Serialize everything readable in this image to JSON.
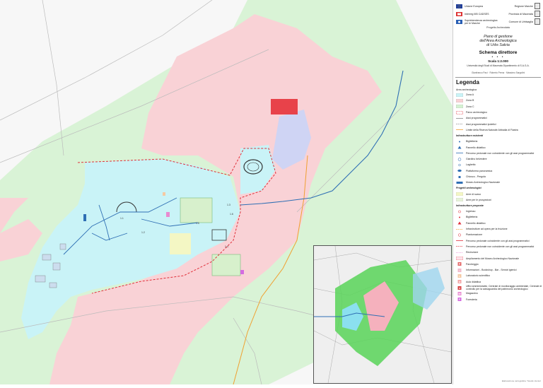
{
  "header": {
    "logos": [
      {
        "left": "Unione Europea",
        "right": "Regione Marche"
      },
      {
        "left": "Interreg IIIB CADSES",
        "right": "Provincia di Macerata"
      },
      {
        "left": "Soprintendenza archeologica per le Marche",
        "right": "Comune di Urbisaglia"
      }
    ],
    "project": "Progetto Archeodata",
    "title_lines": [
      "Piano di gestione",
      "dell'Area Archeologica",
      "di Urbs Salvia"
    ],
    "subtitle": "Schema direttore",
    "dots": "• • •",
    "scale": "Scala 1:2.000",
    "university": "Università degli Studi di Macerata Dipartimento di S.A.G.A.",
    "authors": "Gianfranco Paci · Roberto Perna · Massimo Sargolini"
  },
  "legend": {
    "title": "Legenda",
    "area_heading": "Area archeologica",
    "zones": [
      {
        "label": "Zona A",
        "color": "#c9f3f7"
      },
      {
        "label": "Zona B",
        "color": "#f9d2d6"
      },
      {
        "label": "Zona C",
        "color": "#d5f2d2"
      }
    ],
    "area_items": [
      {
        "label": "Parco archeologico",
        "style": "dash-red"
      },
      {
        "label": "Assi programmatici",
        "style": "line-grey"
      },
      {
        "label": "Assi programmatici ipotetici",
        "style": "dash-grey"
      },
      {
        "label": "Limite della Riserva Naturale Abbadia di Fiastra",
        "style": "line-orange"
      }
    ],
    "existing_heading": "Infrastrutture esistenti",
    "existing": [
      {
        "label": "Biglietteria",
        "icon": "dot"
      },
      {
        "label": "Pannello didattico",
        "icon": "triangle"
      },
      {
        "label": "Percorso pedonale non coincidente con gli assi programmatici",
        "icon": "line-blue"
      },
      {
        "label": "Giardino belvedere",
        "icon": "circle"
      },
      {
        "label": "Laghetto",
        "icon": "small-circle"
      },
      {
        "label": "Piattaforma panoramica",
        "icon": "ellipse"
      },
      {
        "label": "Chiosco - Pergola",
        "icon": "square"
      },
      {
        "label": "Museo Archeologico Nazionale",
        "icon": "rect-blue"
      }
    ],
    "projects_heading": "Progetti archeologici",
    "projects": [
      {
        "label": "Aree di scavo",
        "color": "#f4f7c4"
      },
      {
        "label": "Aree per le prospezioni",
        "color": "#e6f2d8"
      }
    ],
    "planned_heading": "Infrastrutture proposte",
    "planned": [
      {
        "label": "Ingresso",
        "icon": "entry"
      },
      {
        "label": "Biglietteria",
        "icon": "dot-red"
      },
      {
        "label": "Pannello didattico",
        "icon": "triangle-red"
      },
      {
        "label": "Infrastrutture ad opera per la fruizione",
        "icon": "dash-orange"
      },
      {
        "label": "Piantumazione",
        "icon": "circle-red"
      },
      {
        "label": "Percorso pedonale coincidente con gli assi programmatici",
        "icon": "line-red"
      },
      {
        "label": "Percorso pedonale non coincidente con gli assi programmatici",
        "icon": "dash-red2"
      },
      {
        "label": "Recinzione",
        "icon": "dash-pink"
      },
      {
        "label": "Ampliamento del Museo Archeologico Nazionale",
        "icon": "hatch-pink"
      },
      {
        "label": "Parcheggio",
        "icon": "P",
        "color": "#e46a6a"
      },
      {
        "label": "Informazioni - Bookshop - Bar - Servizi igienici",
        "icon": "I",
        "color": "#f0b7c9"
      },
      {
        "label": "Laboratorio scientifico",
        "icon": "L",
        "color": "#f5c9a3"
      },
      {
        "label": "Aula didattica",
        "icon": "A",
        "color": "#f3a3a3"
      },
      {
        "label": "Uffici amministrativi, Centrale di monitoraggio ambientale, Centrale di controllo per la salvaguardia del patrimonio archeologico",
        "icon": "U",
        "color": "#d63a3a"
      },
      {
        "label": "Magazzino",
        "icon": "M",
        "color": "#e98ad0"
      },
      {
        "label": "Foresteria",
        "icon": "F",
        "color": "#d46be0"
      }
    ]
  },
  "map": {
    "labels": [
      "1.3",
      "1.4",
      "1.5",
      "1.6",
      "1.1",
      "1.2"
    ]
  },
  "colors": {
    "zone_a": "#c9f3f7",
    "zone_b": "#f9d2d6",
    "zone_c": "#d5f2d2",
    "river": "#2f6fb4",
    "park_boundary": "#e0303a"
  },
  "footer": {
    "credit": "Elaborazione cartografica: Tonello Venturi"
  }
}
